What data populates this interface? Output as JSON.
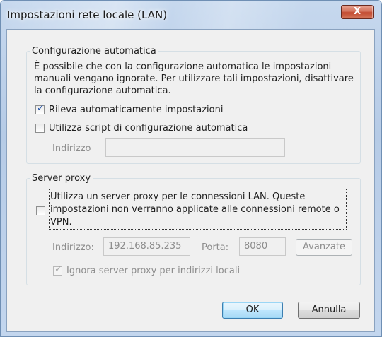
{
  "window": {
    "title": "Impostazioni rete locale (LAN)",
    "close_glyph": "X"
  },
  "auto_config": {
    "legend": "Configurazione automatica",
    "description_lines": [
      "È possibile che con la configurazione automatica le impostazioni",
      "manuali vengano ignorate. Per utilizzare tali impostazioni, disattivare",
      "la configurazione automatica."
    ],
    "detect_label": "Rileva automaticamente impostazioni",
    "detect_checked": true,
    "script_label": "Utilizza script di configurazione automatica",
    "script_checked": false,
    "address_label": "Indirizzo",
    "address_value": ""
  },
  "proxy": {
    "legend": "Server proxy",
    "use_proxy_lines": [
      "Utilizza un server proxy per le connessioni LAN. Queste",
      "impostazioni non verranno applicate alle connessioni remote o",
      "VPN."
    ],
    "use_proxy_checked": false,
    "address_label": "Indirizzo:",
    "address_value": "192.168.85.235",
    "port_label": "Porta:",
    "port_value": "8080",
    "advanced_label": "Avanzate",
    "bypass_label": "Ignora server proxy per indirizzi locali",
    "bypass_checked": true
  },
  "buttons": {
    "ok_label": "OK",
    "cancel_label": "Annulla"
  },
  "colors": {
    "title_bar": "#b6cbe6",
    "close_button": "#c24a30",
    "dialog_background": "#f0f0f0",
    "checkmark": "#1d4fa7"
  },
  "icons": {
    "close": "close-icon",
    "checkmark": "checkmark-icon"
  }
}
